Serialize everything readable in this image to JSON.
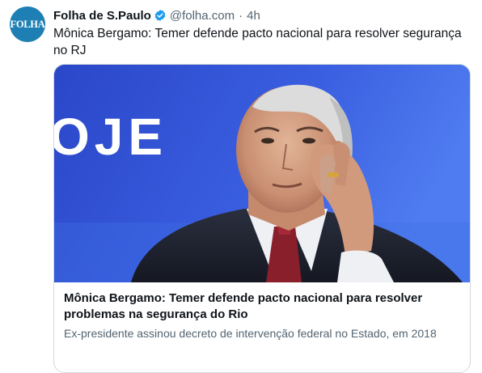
{
  "tweet": {
    "avatar_text": "FOLHA",
    "display_name": "Folha de S.Paulo",
    "handle": "@folha.com",
    "separator": "·",
    "time": "4h",
    "text": "Mônica Bergamo: Temer defende pacto nacional para resolver segurança no RJ"
  },
  "card": {
    "image_text": "OJE",
    "title": "Mônica Bergamo: Temer defende pacto nacional para resolver problemas na segurança do Rio",
    "description": "Ex-presidente assinou decreto de intervenção federal no Estado, em 2018"
  },
  "colors": {
    "brand_blue": "#1d7fb3",
    "verified_blue": "#1d9bf0",
    "image_background": "#2d4fcf",
    "secondary_text": "#536471"
  }
}
